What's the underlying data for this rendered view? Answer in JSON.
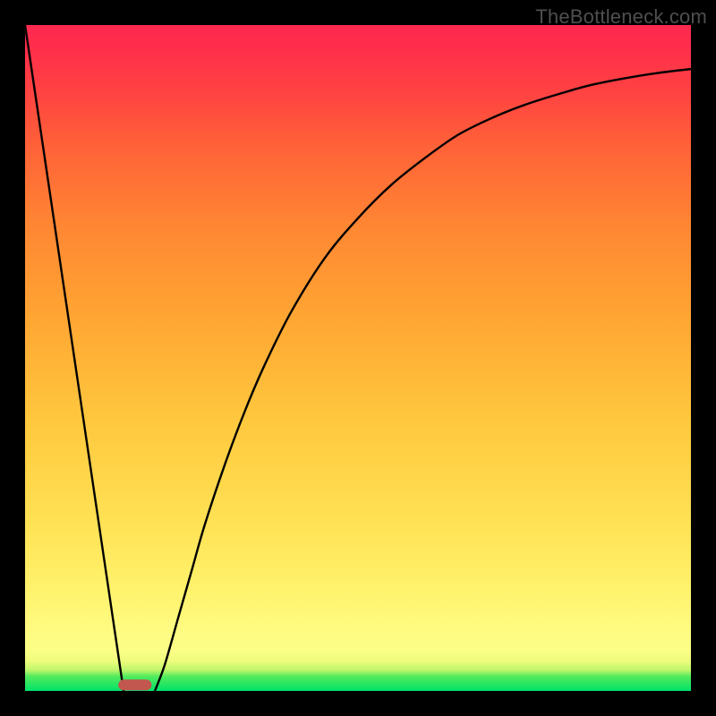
{
  "watermark": "TheBottleneck.com",
  "chart_data": {
    "type": "line",
    "title": "",
    "xlabel": "",
    "ylabel": "",
    "xlim": [
      0,
      100
    ],
    "ylim": [
      0,
      100
    ],
    "grid": false,
    "legend": false,
    "left_segment": {
      "x": [
        0,
        14.8
      ],
      "y": [
        100,
        0
      ]
    },
    "minimum_marker": {
      "x_range": [
        14.0,
        19.0
      ],
      "y": 0.9,
      "color": "#c1574e"
    },
    "right_curve": {
      "x": [
        19.5,
        21,
        23,
        25,
        27,
        30,
        33,
        36,
        40,
        45,
        50,
        55,
        60,
        65,
        70,
        75,
        80,
        85,
        90,
        95,
        100
      ],
      "y": [
        0,
        4,
        11,
        18,
        25,
        34,
        42,
        49,
        57,
        65,
        71,
        76,
        80,
        83.5,
        86,
        88,
        89.6,
        91,
        92,
        92.8,
        93.4
      ]
    },
    "background_gradient": {
      "top_color": "#ff2950",
      "bottom_color": "#00e268"
    }
  }
}
